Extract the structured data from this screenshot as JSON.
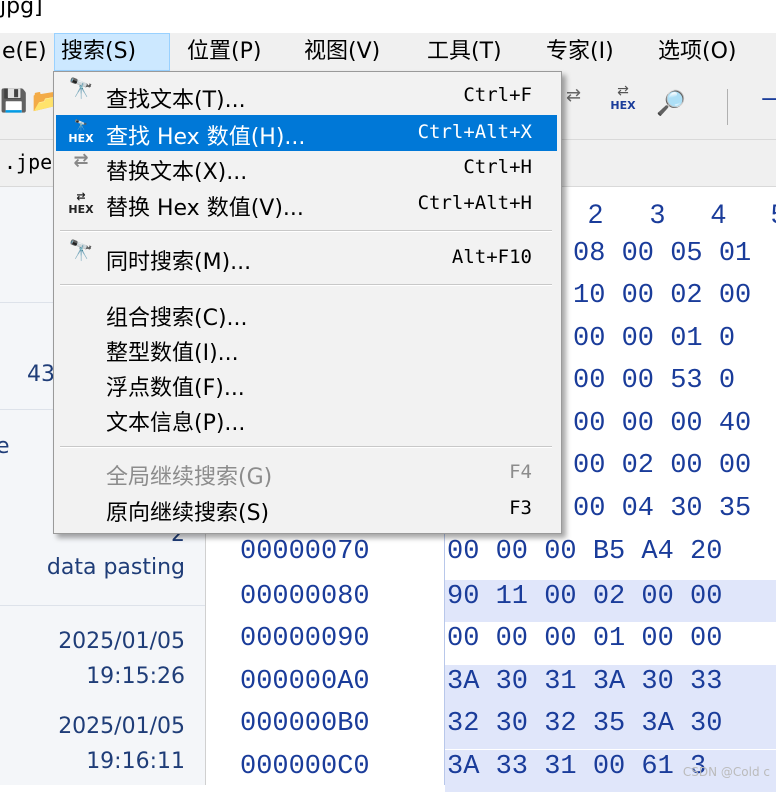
{
  "window": {
    "title_fragment": "jpg]"
  },
  "menubar": {
    "items": [
      {
        "label": "e(E)"
      },
      {
        "label": "搜索(S)"
      },
      {
        "label": "位置(P)"
      },
      {
        "label": "视图(V)"
      },
      {
        "label": "工具(T)"
      },
      {
        "label": "专家(I)"
      },
      {
        "label": "选项(O)"
      }
    ]
  },
  "toolbar": {
    "hex_label": "HEX"
  },
  "tab": {
    "label": ".jpe"
  },
  "search_menu": {
    "items": [
      {
        "label": "查找文本(T)...",
        "shortcut": "Ctrl+F",
        "icon": "binoculars-icon"
      },
      {
        "label": "查找 Hex 数值(H)...",
        "shortcut": "Ctrl+Alt+X",
        "icon": "hex-binoculars-icon"
      },
      {
        "label": "替换文本(X)...",
        "shortcut": "Ctrl+H",
        "icon": "replace-text-icon"
      },
      {
        "label": "替换 Hex 数值(V)...",
        "shortcut": "Ctrl+Alt+H",
        "icon": "replace-hex-icon"
      },
      {
        "label": "同时搜索(M)...",
        "shortcut": "Alt+F10",
        "icon": "binoculars-icon"
      },
      {
        "label": "组合搜索(C)...",
        "shortcut": ""
      },
      {
        "label": "整型数值(I)...",
        "shortcut": ""
      },
      {
        "label": "浮点数值(F)...",
        "shortcut": ""
      },
      {
        "label": "文本信息(P)...",
        "shortcut": ""
      },
      {
        "label": "全局继续搜索(G)",
        "shortcut": "F4",
        "disabled": true
      },
      {
        "label": "原向继续搜索(S)",
        "shortcut": "F3"
      }
    ]
  },
  "left_panel": {
    "texts": [
      "43",
      "e",
      "2",
      "data pasting",
      "2025/01/05",
      "19:15:26",
      "2025/01/05",
      "19:16:11"
    ]
  },
  "hex_header": {
    "columns": [
      "2",
      "3",
      "4",
      "5"
    ]
  },
  "hex_rows": [
    {
      "offset": "",
      "bytes": "08 00 05 01"
    },
    {
      "offset": "",
      "bytes": "10 00 02 00"
    },
    {
      "offset": "",
      "bytes": "00 00 01 0"
    },
    {
      "offset": "",
      "bytes": "00 00 53 0"
    },
    {
      "offset": "",
      "bytes": "00 00 00 40"
    },
    {
      "offset": "",
      "bytes": "00 02 00 00"
    },
    {
      "offset": "",
      "bytes": "00 04 30 35"
    },
    {
      "offset": "00000070",
      "bytes": "00 00 00 B5 A4 20"
    },
    {
      "offset": "00000080",
      "bytes": "90 11 00 02 00 00"
    },
    {
      "offset": "00000090",
      "bytes": "00 00 00 01 00 00"
    },
    {
      "offset": "000000A0",
      "bytes": "3A 30 31 3A 30 33"
    },
    {
      "offset": "000000B0",
      "bytes": "32 30 32 35 3A 30"
    },
    {
      "offset": "000000C0",
      "bytes": "3A 33 31 00 61 3"
    }
  ],
  "watermark": "CSDN @Cold c",
  "colors": {
    "menu_highlight": "#0078d7",
    "active_menu_bg": "#cce8ff",
    "hex_text": "#1a3c9a",
    "row_highlight": "#e0e6fa"
  }
}
